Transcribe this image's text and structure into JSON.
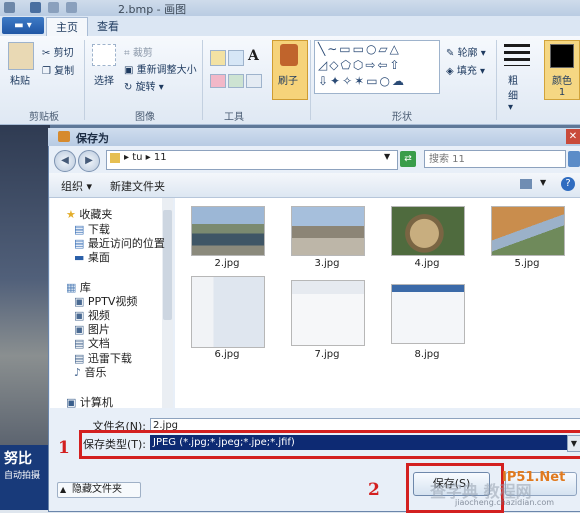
{
  "app": {
    "title": "2.bmp - 画图",
    "tabs": [
      "主页",
      "查看"
    ],
    "groups": {
      "clipboard": {
        "label": "剪贴板",
        "paste": "粘贴",
        "cut": "剪切",
        "copy": "复制"
      },
      "image": {
        "label": "图像",
        "select": "选择",
        "crop": "裁剪",
        "resize": "重新调整大小",
        "rotate": "旋转"
      },
      "tools": {
        "label": "工具"
      },
      "brushes": {
        "label": "刷子"
      },
      "shapes": {
        "label": "形状",
        "outline": "轮廓",
        "fill": "填充"
      },
      "size": {
        "label": "粗细"
      },
      "color1": {
        "label": "颜色 1"
      }
    }
  },
  "banner": {
    "big": "努比",
    "small": "自动拍摄"
  },
  "dialog": {
    "title": "保存为",
    "address": "▸ tu ▸ 11",
    "search_placeholder": "搜索 11",
    "toolbar": {
      "organize": "组织 ▾",
      "new_folder": "新建文件夹"
    },
    "nav_items": [
      {
        "label": "收藏夹",
        "icon": "star-icon"
      },
      {
        "label": "下载",
        "icon": "download-icon"
      },
      {
        "label": "最近访问的位置",
        "icon": "recent-icon"
      },
      {
        "label": "桌面",
        "icon": "desktop-icon"
      },
      {
        "label": "库",
        "icon": "library-icon"
      },
      {
        "label": "PPTV视频",
        "icon": "video-icon"
      },
      {
        "label": "视频",
        "icon": "video-icon"
      },
      {
        "label": "图片",
        "icon": "image-icon"
      },
      {
        "label": "文档",
        "icon": "document-icon"
      },
      {
        "label": "迅雷下载",
        "icon": "download-icon"
      },
      {
        "label": "音乐",
        "icon": "music-icon"
      },
      {
        "label": "计算机",
        "icon": "computer-icon"
      }
    ],
    "files": [
      {
        "name": "2.jpg",
        "kind": "photo"
      },
      {
        "name": "3.jpg",
        "kind": "photo"
      },
      {
        "name": "4.jpg",
        "kind": "photo"
      },
      {
        "name": "5.jpg",
        "kind": "photo"
      },
      {
        "name": "6.jpg",
        "kind": "screenshot"
      },
      {
        "name": "7.jpg",
        "kind": "screenshot"
      },
      {
        "name": "8.jpg",
        "kind": "screenshot"
      }
    ],
    "filename_label": "文件名(N):",
    "filename_value": "2.jpg",
    "filetype_label": "保存类型(T):",
    "filetype_value": "JPEG (*.jpg;*.jpeg;*.jpe;*.jfif)",
    "hide_folders": "隐藏文件夹",
    "save_button": "保存(S)"
  },
  "annotations": {
    "step1": "1",
    "step2": "2"
  },
  "watermark": {
    "logo": "IP51.Net",
    "text": "查字典 教程网",
    "url": "jiaocheng.chazidian.com"
  },
  "colors": {
    "highlight": "#d32020",
    "dialog_bg": "#e8eff8",
    "selection": "#0d2a73"
  }
}
